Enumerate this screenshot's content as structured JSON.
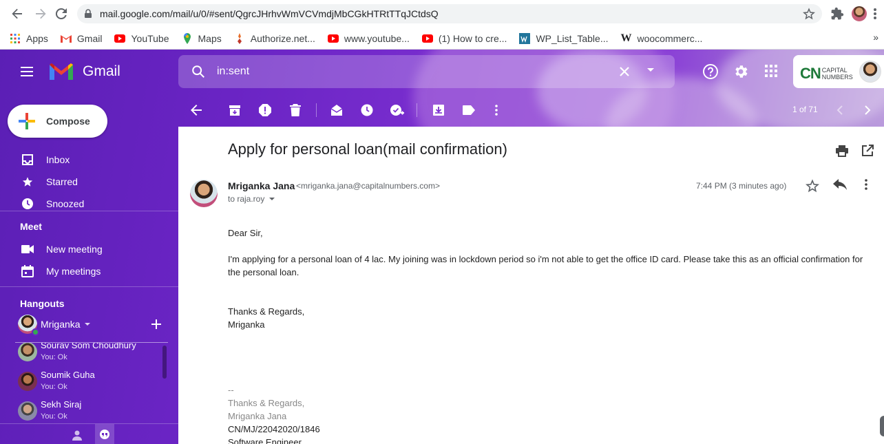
{
  "browser": {
    "url": "mail.google.com/mail/u/0/#sent/QgrcJHrhvWmVCVmdjMbCGkHTRtTTqJCtdsQ",
    "bookmarks": [
      {
        "label": "Apps"
      },
      {
        "label": "Gmail"
      },
      {
        "label": "YouTube"
      },
      {
        "label": "Maps"
      },
      {
        "label": "Authorize.net..."
      },
      {
        "label": "www.youtube..."
      },
      {
        "label": "(1) How to cre..."
      },
      {
        "label": "WP_List_Table..."
      },
      {
        "label": "woocommerc..."
      }
    ],
    "more_bookmarks": "»"
  },
  "gmail": {
    "logo_text": "Gmail",
    "search_value": "in:sent",
    "account_logo": {
      "cn": "CN",
      "line1": "CAPITAL",
      "line2": "NUMBERS"
    }
  },
  "sidebar": {
    "compose_label": "Compose",
    "items": [
      {
        "label": "Inbox",
        "icon": "inbox-icon"
      },
      {
        "label": "Starred",
        "icon": "star-icon"
      },
      {
        "label": "Snoozed",
        "icon": "clock-icon"
      }
    ],
    "meet": {
      "heading": "Meet",
      "items": [
        {
          "label": "New meeting",
          "icon": "video-icon"
        },
        {
          "label": "My meetings",
          "icon": "calendar-icon"
        }
      ]
    },
    "hangouts": {
      "heading": "Hangouts",
      "user": "Mriganka",
      "contacts": [
        {
          "name": "Sourav Som Choudhury",
          "status": "You: Ok"
        },
        {
          "name": "Soumik Guha",
          "status": "You: Ok"
        },
        {
          "name": "Sekh Siraj",
          "status": "You: Ok"
        }
      ]
    }
  },
  "toolbar": {
    "pager": "1 of 71"
  },
  "message": {
    "subject": "Apply for personal loan(mail confirmation)",
    "sender_name": "Mriganka Jana",
    "sender_email": "<mriganka.jana@capitalnumbers.com>",
    "to": "to raja.roy",
    "time": "7:44 PM (3 minutes ago)",
    "greeting": "Dear Sir,",
    "paragraph": "I'm applying for a personal loan of 4 lac. My joining was in lockdown period so i'm not able to get the office ID card. Please take this as an official confirmation for the personal loan.",
    "closing": "Thanks & Regards,",
    "closing_name": "Mriganka",
    "sig_dashes": "--",
    "sig_regards": "Thanks & Regards,",
    "sig_name": "Mriganka Jana",
    "sig_id": "CN/MJ/22042020/1846",
    "sig_title": "Software Engineer"
  },
  "colors": {
    "accent_purple": "#6a24c4",
    "gmail_red": "#ea4335"
  }
}
